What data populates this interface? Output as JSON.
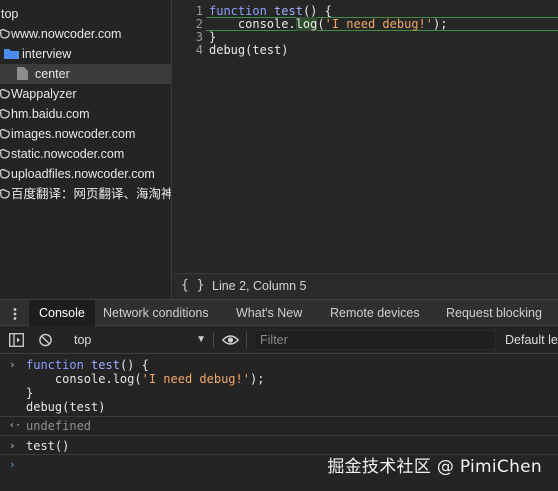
{
  "sidebar": {
    "items": [
      {
        "label": "top",
        "icon": "frame-icon"
      },
      {
        "label": "www.nowcoder.com",
        "icon": "cloud-icon"
      },
      {
        "label": "interview",
        "icon": "folder-icon"
      },
      {
        "label": "center",
        "icon": "file-icon"
      },
      {
        "label": "Wappalyzer",
        "icon": "cloud-icon"
      },
      {
        "label": "hm.baidu.com",
        "icon": "cloud-icon"
      },
      {
        "label": "images.nowcoder.com",
        "icon": "cloud-icon"
      },
      {
        "label": "static.nowcoder.com",
        "icon": "cloud-icon"
      },
      {
        "label": "uploadfiles.nowcoder.com",
        "icon": "cloud-icon"
      },
      {
        "label": "百度翻译：网页翻译、海淘神器",
        "icon": "cloud-icon"
      }
    ],
    "selected_label": "center"
  },
  "editor": {
    "line_numbers": [
      "1",
      "2",
      "3",
      "4"
    ],
    "lines": {
      "l1_kw": "function",
      "l1_name": "test",
      "l1_rest": "() {",
      "l2_indent": "    ",
      "l2_obj": "console.",
      "l2_method": "log",
      "l2_paren": "(",
      "l2_str": "'I need debug!'",
      "l2_end": ");",
      "l3": "}",
      "l4": "debug(test)"
    },
    "active_line": 2
  },
  "status_bar": {
    "braces": "{ }",
    "cursor_position": "Line 2, Column 5"
  },
  "drawer": {
    "tabs": [
      "Console",
      "Network conditions",
      "What's New",
      "Remote devices",
      "Request blocking"
    ],
    "active_tab": "Console"
  },
  "console_toolbar": {
    "context": "top",
    "filter_placeholder": "Filter",
    "levels_label": "Default lev"
  },
  "console": {
    "entry1": {
      "kw": "function",
      "name": "test",
      "rest": "() {",
      "line2_indent": "    ",
      "line2_obj": "console.log(",
      "line2_str": "'I need debug!'",
      "line2_end": ");",
      "line3": "}",
      "line4": "debug(test)"
    },
    "result1": "undefined",
    "entry2": "test()"
  },
  "watermark": "掘金技术社区 @ PimiChen",
  "colors": {
    "background": "#242424",
    "keyword": "#8ca0ff",
    "string": "#f0a766",
    "active_line_border": "#3f8f3f",
    "prompt_blue": "#5a9cf8"
  }
}
